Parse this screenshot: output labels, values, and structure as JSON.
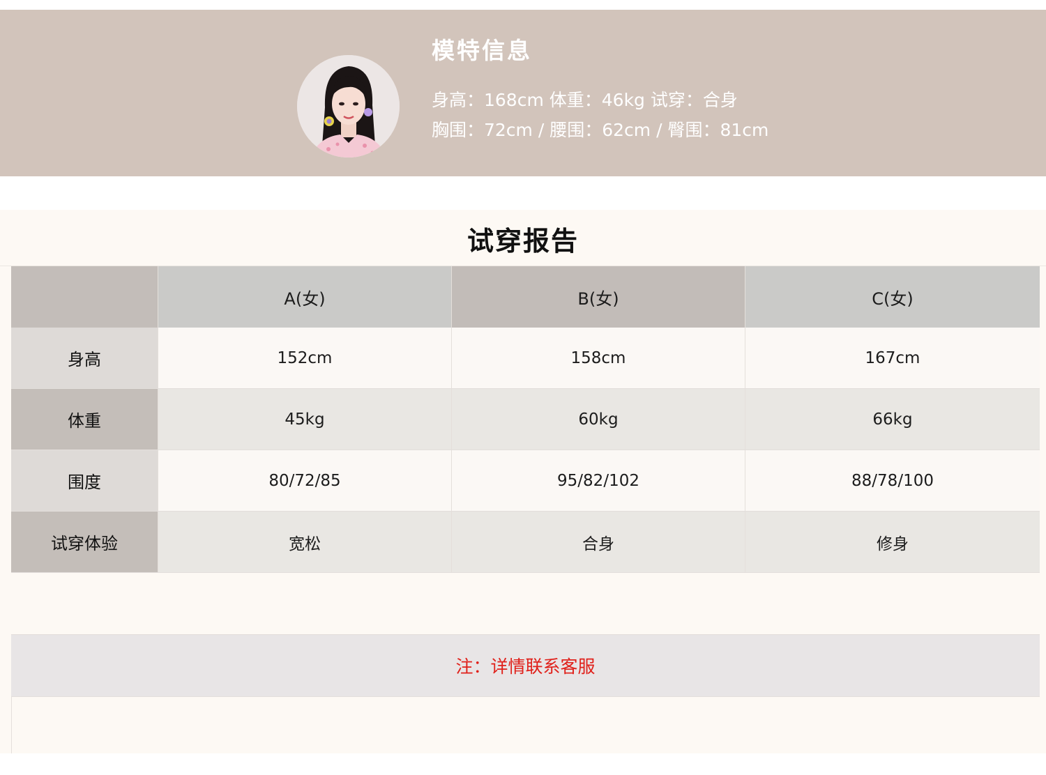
{
  "model": {
    "title": "模特信息",
    "line1": "身高：168cm  体重：46kg  试穿：合身",
    "line2": "胸围：72cm / 腰围：62cm / 臀围：81cm"
  },
  "report": {
    "title": "试穿报告",
    "columns": [
      "",
      "A(女)",
      "B(女)",
      "C(女)"
    ],
    "rows": [
      {
        "label": "身高",
        "values": [
          "152cm",
          "158cm",
          "167cm"
        ]
      },
      {
        "label": "体重",
        "values": [
          "45kg",
          "60kg",
          "66kg"
        ]
      },
      {
        "label": "围度",
        "values": [
          "80/72/85",
          "95/82/102",
          "88/78/100"
        ]
      },
      {
        "label": "试穿体验",
        "values": [
          "宽松",
          "合身",
          "修身"
        ]
      }
    ],
    "note": "注：详情联系客服"
  },
  "colors": {
    "banner": "#d2c4bb",
    "note_text": "#e0201a",
    "report_bg": "#fdf9f4"
  }
}
